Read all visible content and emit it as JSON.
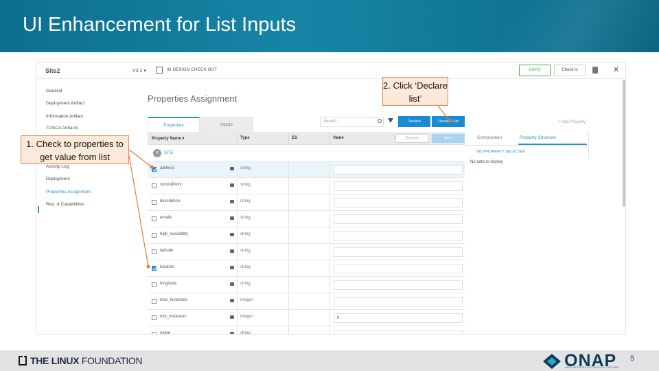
{
  "slide": {
    "title": "UI Enhancement for List Inputs",
    "page_number": "5",
    "footer_left_bold": "THE LINUX",
    "footer_left_regular": " FOUNDATION",
    "footer_right_logo": "ONAP",
    "footer_right_sub": "OPEN NETWORK AUTOMATION PLATFORM"
  },
  "callouts": {
    "step1": "1. Check to properties to get value from list",
    "step2": "2. Click ‘Declare list’"
  },
  "app": {
    "site_name": "Site2",
    "version": "V3.2 ▾",
    "state": "IN DESIGN CHECK OUT",
    "certify_label": "Certify",
    "checkin_label": "Check in",
    "close_glyph": "✕",
    "sidebar": [
      {
        "label": "General",
        "active": false
      },
      {
        "label": "Deployment Artifact",
        "active": false
      },
      {
        "label": "Information Artifact",
        "active": false
      },
      {
        "label": "TOSCA Artifacts",
        "active": false
      },
      {
        "label": "Activity Log",
        "active": false
      },
      {
        "label": "Deployment",
        "active": false
      },
      {
        "label": "Properties Assignment",
        "active": true
      },
      {
        "label": "Req. & Capabilities",
        "active": false
      }
    ],
    "main_title": "Properties Assignment",
    "tabs": [
      "Properties",
      "Inputs"
    ],
    "search_placeholder": "Search",
    "declare_label": "Declare",
    "declare_list_label": "Declare List",
    "add_property_label": "+ Add Property",
    "columns": [
      "Property Name ▾",
      "Type",
      "ES",
      "Value"
    ],
    "discard_label": "Discard",
    "save_label": "Save",
    "group_badge": "II",
    "group_label": "SITE",
    "properties": [
      {
        "name": "address",
        "type": "string",
        "checked": true,
        "value": ""
      },
      {
        "name": "controlPoint",
        "type": "string",
        "checked": false,
        "value": ""
      },
      {
        "name": "description",
        "type": "string",
        "checked": false,
        "value": ""
      },
      {
        "name": "emails",
        "type": "string",
        "checked": false,
        "value": ""
      },
      {
        "name": "high_availablity",
        "type": "string",
        "checked": false,
        "value": ""
      },
      {
        "name": "latitude",
        "type": "string",
        "checked": false,
        "value": ""
      },
      {
        "name": "location",
        "type": "string",
        "checked": true,
        "value": ""
      },
      {
        "name": "longitude",
        "type": "string",
        "checked": false,
        "value": ""
      },
      {
        "name": "max_instances",
        "type": "integer",
        "checked": false,
        "value": ""
      },
      {
        "name": "min_instances",
        "type": "integer",
        "checked": false,
        "value": "0"
      },
      {
        "name": "name",
        "type": "string",
        "checked": false,
        "value": ""
      }
    ],
    "right_panel": {
      "tab_composition": "Composition",
      "tab_property_structure": "Property Structure",
      "status": "NO PROPERTY SELECTED",
      "empty_message": "No data to display"
    }
  }
}
